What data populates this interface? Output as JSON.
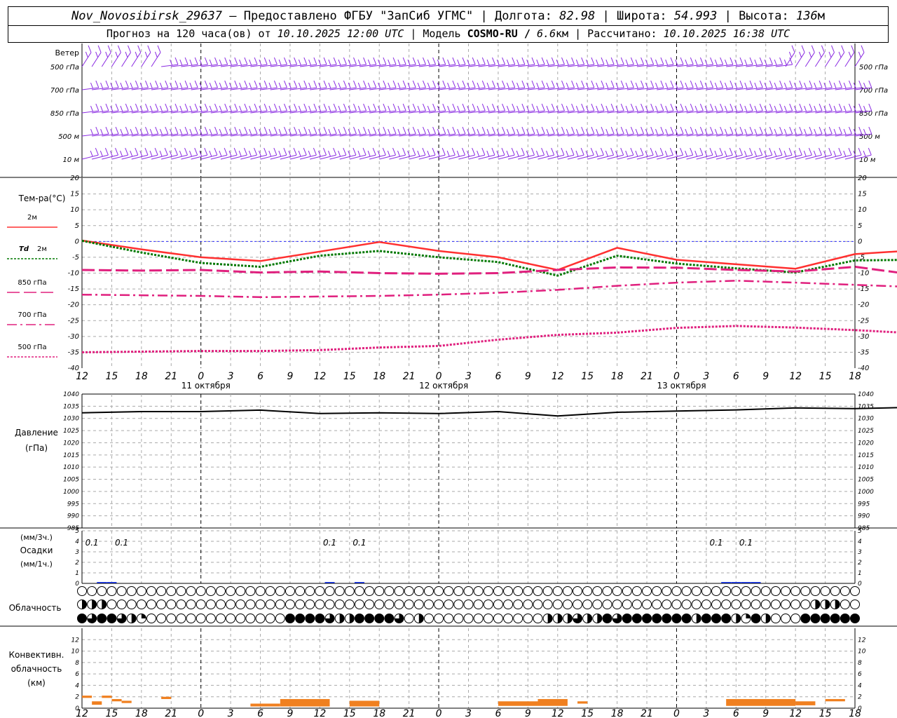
{
  "header": {
    "station": "Nov_Novosibirsk_29637",
    "provider": "— Предоставлено ФГБУ \"ЗапСиб УГМС\" |",
    "lon_label": "Долгота:",
    "lon": "82.98",
    "lat_label": "| Широта:",
    "lat": "54.993",
    "alt_label": "| Высота:",
    "alt": "136",
    "alt_unit": "м",
    "fc_label": "Прогноз на 120 часа(ов) от",
    "fc_from": "10.10.2025 12:00 UTC",
    "model_label": "| Модель",
    "model": "COSMO-RU /",
    "res": "6.6",
    "res_unit": "км",
    "calc_label": "| Рассчитано:",
    "calc": "10.10.2025 16:38 UTC"
  },
  "colors": {
    "wind": "#8a2be2",
    "t2m": "#ff3030",
    "td2m": "#007800",
    "t850": "#e0207e",
    "t700": "#e0207e",
    "t500": "#e0207e",
    "zero_line": "#3030ff",
    "pressure": "#000000",
    "precip": "#2040ff",
    "convective": "#f08020"
  },
  "chart_data": [
    {
      "type": "wind-barbs",
      "panel_label": "Ветер",
      "levels": [
        "500 гПа",
        "700 гПа",
        "850 гПа",
        "500 м",
        "10 м"
      ],
      "note": "wind barbs at 5 levels, predominantly westerly, every 1 h from 10.10 12 UTC to 13.10 18 UTC"
    },
    {
      "type": "line",
      "ylabel": "Тем-ра(°C)",
      "ylim": [
        -40,
        20
      ],
      "yticks": [
        20,
        15,
        10,
        5,
        0,
        -5,
        -10,
        -15,
        -20,
        -25,
        -30,
        -35,
        -40
      ],
      "x_hours": [
        0,
        6,
        12,
        18,
        24,
        30,
        36,
        42,
        48,
        54,
        60,
        66,
        72,
        78
      ],
      "series": [
        {
          "name": "2м",
          "values": [
            0.3,
            -2.5,
            -5.0,
            -6.2,
            -3.2,
            -0.2,
            -3.0,
            -5.0,
            -9.0,
            -2.0,
            -5.8,
            -7.2,
            -8.6,
            -4.0
          ]
        },
        {
          "name": "Td 2м",
          "values": [
            0.2,
            -3.5,
            -6.8,
            -8.0,
            -4.5,
            -3.0,
            -5.0,
            -6.5,
            -10.8,
            -4.5,
            -7.0,
            -8.5,
            -9.8,
            -6.0
          ]
        },
        {
          "name": "850 гПа",
          "values": [
            -9.0,
            -9.2,
            -9.0,
            -9.8,
            -9.5,
            -10.0,
            -10.2,
            -10.0,
            -9.0,
            -8.2,
            -8.3,
            -9.0,
            -9.5,
            -8.0
          ]
        },
        {
          "name": "700 гПа",
          "values": [
            -16.8,
            -17.0,
            -17.2,
            -17.6,
            -17.4,
            -17.2,
            -16.8,
            -16.2,
            -15.3,
            -14.0,
            -13.0,
            -12.4,
            -13.0,
            -13.7
          ]
        },
        {
          "name": "500 гПа",
          "values": [
            -35.0,
            -34.8,
            -34.6,
            -34.6,
            -34.3,
            -33.5,
            -33.0,
            -31.0,
            -29.5,
            -28.8,
            -27.3,
            -26.7,
            -27.2,
            -28.0
          ]
        }
      ],
      "tail_values": {
        "2м": [
          -2.8,
          -4.2,
          -6.3
        ],
        "Td 2м": [
          -5.8,
          -6.0,
          -7.8
        ],
        "850 гПа": [
          -10.5,
          -12.0,
          -11.0
        ],
        "700 гПа": [
          -14.4,
          -15.5,
          -16.0
        ],
        "500 гПа": [
          -29.0,
          -29.8,
          -29.7
        ]
      },
      "tail_hours": [
        84,
        90,
        96
      ]
    },
    {
      "type": "line",
      "ylabel": "Давление",
      "yunit": "(гПа)",
      "ylim": [
        985,
        1040
      ],
      "yticks": [
        1040,
        1035,
        1030,
        1025,
        1020,
        1015,
        1010,
        1005,
        1000,
        995,
        990,
        985
      ],
      "x_hours": [
        0,
        6,
        12,
        18,
        24,
        30,
        36,
        42,
        48,
        54,
        60,
        66,
        72,
        78,
        84,
        90,
        96
      ],
      "series": [
        {
          "name": "Давление",
          "values": [
            1032.3,
            1032.8,
            1032.8,
            1033.4,
            1032.0,
            1032.3,
            1032.0,
            1032.8,
            1031.0,
            1032.5,
            1033.0,
            1033.5,
            1034.3,
            1034.0,
            1034.6,
            1036.0,
            1036.8
          ]
        }
      ]
    },
    {
      "type": "bar",
      "ylabel_top": "(мм/3ч.)",
      "ylabel": "Осадки",
      "ylabel_bottom": "(мм/1ч.)",
      "ylim": [
        0,
        5
      ],
      "yticks": [
        5,
        4,
        3,
        2,
        1,
        0
      ],
      "labels": [
        {
          "hour": 1,
          "text": "0.1"
        },
        {
          "hour": 4,
          "text": "0.1"
        },
        {
          "hour": 25,
          "text": "0.1"
        },
        {
          "hour": 28,
          "text": "0.1"
        },
        {
          "hour": 64,
          "text": "0.1"
        },
        {
          "hour": 67,
          "text": "0.1"
        }
      ],
      "bars": [
        {
          "hour": 2,
          "value": 0.1
        },
        {
          "hour": 3,
          "value": 0.1
        },
        {
          "hour": 25,
          "value": 0.05
        },
        {
          "hour": 28,
          "value": 0.05
        },
        {
          "hour": 65,
          "value": 0.1
        },
        {
          "hour": 66,
          "value": 0.1
        },
        {
          "hour": 67,
          "value": 0.1
        },
        {
          "hour": 68,
          "value": 0.1
        }
      ]
    },
    {
      "type": "table",
      "panel_label": "Облачность",
      "rows": [
        "верхняя",
        "средняя",
        "нижняя"
      ],
      "legend": "circle fill 0 = clear, 1 = overcast",
      "upper": [
        0,
        0,
        0,
        0,
        0,
        0,
        0,
        0,
        0,
        0,
        0,
        0,
        0,
        0,
        0,
        0,
        0,
        0,
        0,
        0,
        0,
        0,
        0,
        0,
        0,
        0,
        0,
        0,
        0,
        0,
        0,
        0,
        0,
        0,
        0,
        0,
        0,
        0,
        0,
        0,
        0,
        0,
        0,
        0,
        0,
        0,
        0,
        0,
        0,
        0,
        0,
        0,
        0,
        0,
        0,
        0,
        0,
        0,
        0,
        0,
        0,
        0,
        0,
        0,
        0,
        0,
        0,
        0,
        0,
        0,
        0,
        0,
        0,
        0,
        0,
        0,
        0,
        0,
        0
      ],
      "middle": [
        0.5,
        0.5,
        0.5,
        0,
        0,
        0,
        0,
        0,
        0,
        0,
        0,
        0,
        0,
        0,
        0,
        0,
        0,
        0,
        0,
        0,
        0,
        0,
        0,
        0,
        0,
        0,
        0,
        0,
        0,
        0,
        0,
        0,
        0,
        0,
        0,
        0,
        0,
        0,
        0,
        0,
        0,
        0,
        0,
        0,
        0,
        0,
        0,
        0,
        0,
        0,
        0,
        0,
        0,
        0,
        0,
        0,
        0,
        0,
        0,
        0,
        0,
        0,
        0,
        0,
        0,
        0,
        0,
        0,
        0,
        0,
        0,
        0,
        0,
        0,
        0.5,
        0.5,
        0.5,
        0,
        0
      ],
      "lower": [
        1,
        0.75,
        1,
        1,
        0.75,
        0.5,
        0.25,
        0,
        0,
        0,
        0,
        0,
        0,
        0,
        0,
        0,
        0,
        0,
        0,
        0,
        0,
        1,
        1,
        1,
        1,
        0.75,
        0.5,
        0.5,
        1,
        1,
        1,
        1,
        0.75,
        0,
        0.5,
        0,
        0,
        0,
        0,
        0,
        0,
        0,
        0,
        0,
        0,
        0,
        0,
        0.5,
        0.5,
        0.5,
        0.75,
        0.5,
        0.5,
        1,
        0.75,
        1,
        1,
        1,
        1,
        1,
        1,
        1,
        0.5,
        1,
        1,
        1,
        0.5,
        0.25,
        1,
        0.5,
        0,
        0,
        0,
        1,
        1,
        1,
        1,
        1,
        1
      ]
    },
    {
      "type": "bar",
      "panel_label": "Конвективн. облачность",
      "yunit": "(км)",
      "ylim": [
        0,
        14
      ],
      "yticks": [
        12,
        10,
        8,
        6,
        4,
        2,
        0
      ],
      "segments": [
        {
          "h0": 0,
          "h1": 1,
          "bottom": 1.8,
          "top": 2.2
        },
        {
          "h0": 1,
          "h1": 2,
          "bottom": 0.6,
          "top": 1.2
        },
        {
          "h0": 2,
          "h1": 3,
          "bottom": 1.8,
          "top": 2.2
        },
        {
          "h0": 3,
          "h1": 4,
          "bottom": 1.2,
          "top": 1.6
        },
        {
          "h0": 4,
          "h1": 5,
          "bottom": 0.9,
          "top": 1.3
        },
        {
          "h0": 8,
          "h1": 9,
          "bottom": 1.6,
          "top": 2.0
        },
        {
          "h0": 17,
          "h1": 20,
          "bottom": 0.3,
          "top": 0.8
        },
        {
          "h0": 20,
          "h1": 25,
          "bottom": 0.3,
          "top": 1.6
        },
        {
          "h0": 27,
          "h1": 30,
          "bottom": 0.3,
          "top": 1.3
        },
        {
          "h0": 42,
          "h1": 46,
          "bottom": 0.4,
          "top": 1.2
        },
        {
          "h0": 46,
          "h1": 49,
          "bottom": 0.4,
          "top": 1.6
        },
        {
          "h0": 50,
          "h1": 51,
          "bottom": 0.8,
          "top": 1.2
        },
        {
          "h0": 65,
          "h1": 72,
          "bottom": 0.4,
          "top": 1.6
        },
        {
          "h0": 72,
          "h1": 74,
          "bottom": 0.5,
          "top": 1.2
        },
        {
          "h0": 75,
          "h1": 77,
          "bottom": 1.2,
          "top": 1.6
        }
      ]
    }
  ],
  "xaxis": {
    "tick_labels": [
      "12",
      "15",
      "18",
      "21",
      "0",
      "3",
      "6",
      "9",
      "12",
      "15",
      "18",
      "21",
      "0",
      "3",
      "6",
      "9",
      "12",
      "15",
      "18",
      "21",
      "0",
      "3",
      "6",
      "9",
      "12",
      "15",
      "18"
    ],
    "date_labels": [
      "11 октября",
      "12 октября",
      "13 октября"
    ]
  },
  "legend": {
    "t2m": "2м",
    "td_prefix": "Td",
    "td_suffix": "2м",
    "t850": "850 гПа",
    "t700": "700 гПа",
    "t500": "500 гПа"
  }
}
